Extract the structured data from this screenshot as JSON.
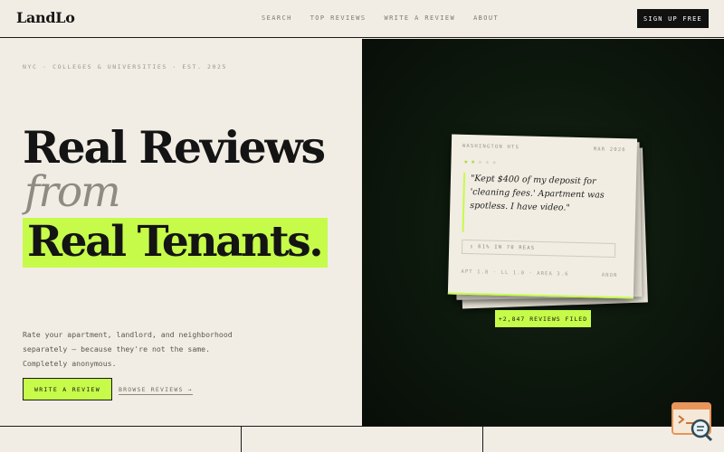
{
  "nav": {
    "logo": "LandLo",
    "links": [
      "SEARCH",
      "TOP REVIEWS",
      "WRITE A REVIEW",
      "ABOUT"
    ],
    "signup_label": "SIGN UP FREE"
  },
  "hero": {
    "eyebrow": "NYC · COLLEGES & UNIVERSITIES · EST. 2025",
    "line1": "Real Reviews",
    "line2": "from",
    "line3": "Real Tenants.",
    "description": "Rate your apartment, landlord, and neighborhood separately — because they're not the same. Completely anonymous.",
    "cta_label": "WRITE A REVIEW",
    "browse_label": "BROWSE REVIEWS →"
  },
  "review_card": {
    "location": "WASHINGTON HTS",
    "date": "MAR 2026",
    "rating": 2,
    "rating_max": 5,
    "quote": "\"Kept $400 of my deposit for 'cleaning fees.' Apartment was spotless. I have video.\"",
    "stat": "▯ 61% IN 70 REAS",
    "scores": "APT 1.8 · LL 1.0 · AREA 3.6",
    "author": "ANON"
  },
  "badge": "+2,847 REVIEWS FILED",
  "colors": {
    "accent": "#c6fb4a",
    "ink": "#141414",
    "paper": "#f2ede4",
    "dark_panel": "#0e1a0e"
  }
}
